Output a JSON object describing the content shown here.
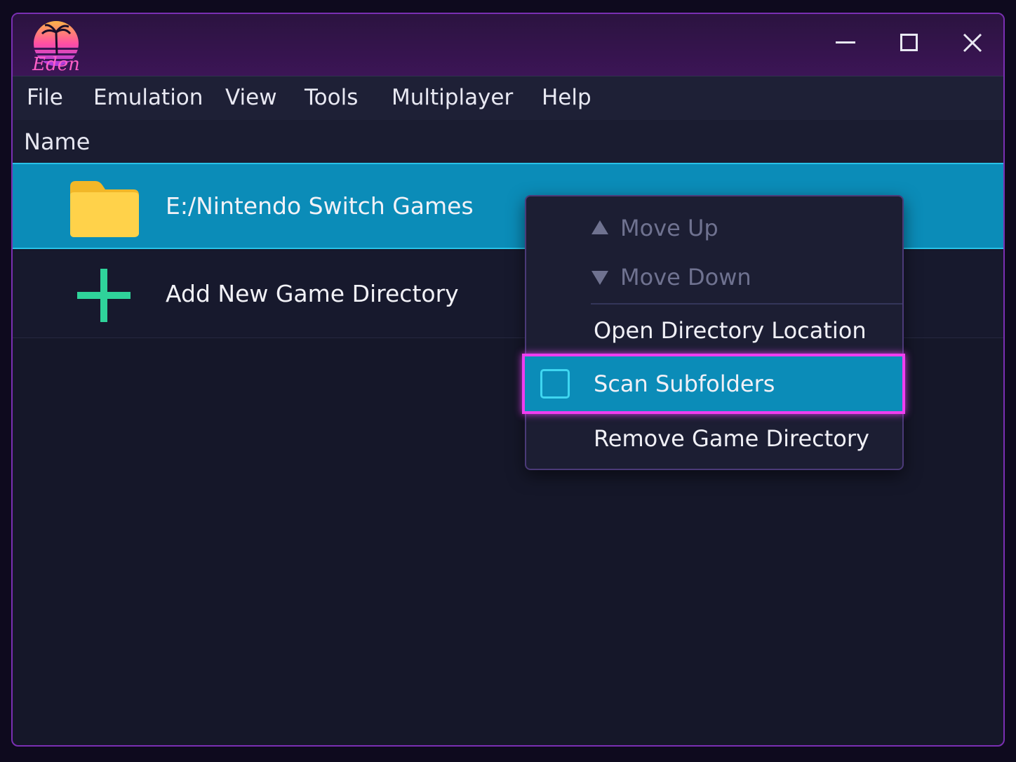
{
  "titlebar": {
    "logo_text": "Eden",
    "minimize_icon": "minimize-icon",
    "maximize_icon": "maximize-icon",
    "close_icon": "close-icon"
  },
  "menu": {
    "items": [
      "File",
      "Emulation",
      "View",
      "Tools",
      "Multiplayer",
      "Help"
    ]
  },
  "table": {
    "header": "Name",
    "rows": [
      {
        "label": "E:/Nintendo Switch Games",
        "icon": "folder-icon",
        "selected": true
      },
      {
        "label": "Add New Game Directory",
        "icon": "plus-icon",
        "selected": false
      }
    ]
  },
  "context_menu": {
    "move_up": "Move Up",
    "move_down": "Move Down",
    "open_location": "Open Directory Location",
    "scan_subfolders": "Scan Subfolders",
    "scan_subfolders_checked": false,
    "remove": "Remove Game Directory"
  },
  "colors": {
    "accent_selection": "#0b8cb8",
    "highlight_border": "#f03ef0",
    "add_icon": "#2fd39a",
    "folder": "#ffd24a"
  }
}
